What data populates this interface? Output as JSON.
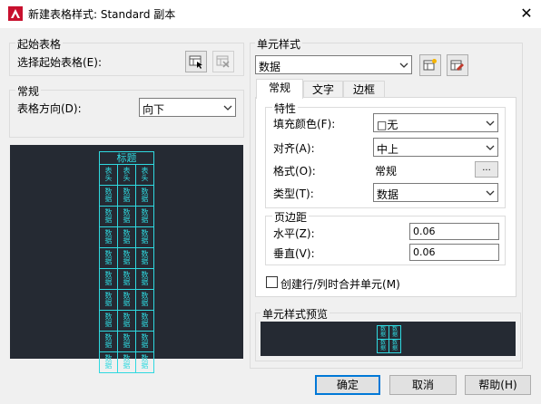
{
  "window": {
    "title": "新建表格样式: Standard 副本",
    "icon": "autocad-app-icon",
    "close_glyph": "✕"
  },
  "starting_table": {
    "group_label": "起始表格",
    "select_label": "选择起始表格(E):"
  },
  "general": {
    "group_label": "常规",
    "direction_label": "表格方向(D):",
    "direction_value": "向下"
  },
  "preview_table": {
    "title_text": "标题",
    "header_text": "表头",
    "data_text": "数据",
    "columns": 3,
    "data_rows": 9
  },
  "cell_style": {
    "group_label": "单元样式",
    "selected": "数据",
    "tabs": [
      {
        "label": "常规",
        "active": true
      },
      {
        "label": "文字",
        "active": false
      },
      {
        "label": "边框",
        "active": false
      }
    ],
    "properties": {
      "group_label": "特性",
      "fill_label": "填充颜色(F):",
      "fill_value": "□无",
      "align_label": "对齐(A):",
      "align_value": "中上",
      "format_label": "格式(O):",
      "format_value": "常规",
      "format_button": "...",
      "type_label": "类型(T):",
      "type_value": "数据"
    },
    "margins": {
      "group_label": "页边距",
      "horizontal_label": "水平(Z):",
      "horizontal_value": "0.06",
      "vertical_label": "垂直(V):",
      "vertical_value": "0.06"
    },
    "merge_label": "创建行/列时合并单元(M)",
    "merge_checked": false
  },
  "cell_preview": {
    "group_label": "单元样式预览",
    "data_text": "数据"
  },
  "buttons": {
    "ok": "确定",
    "cancel": "取消",
    "help": "帮助(H)"
  },
  "colors": {
    "preview_bg": "#252a33",
    "preview_line": "#2fd9e0",
    "accent": "#0078d7"
  }
}
